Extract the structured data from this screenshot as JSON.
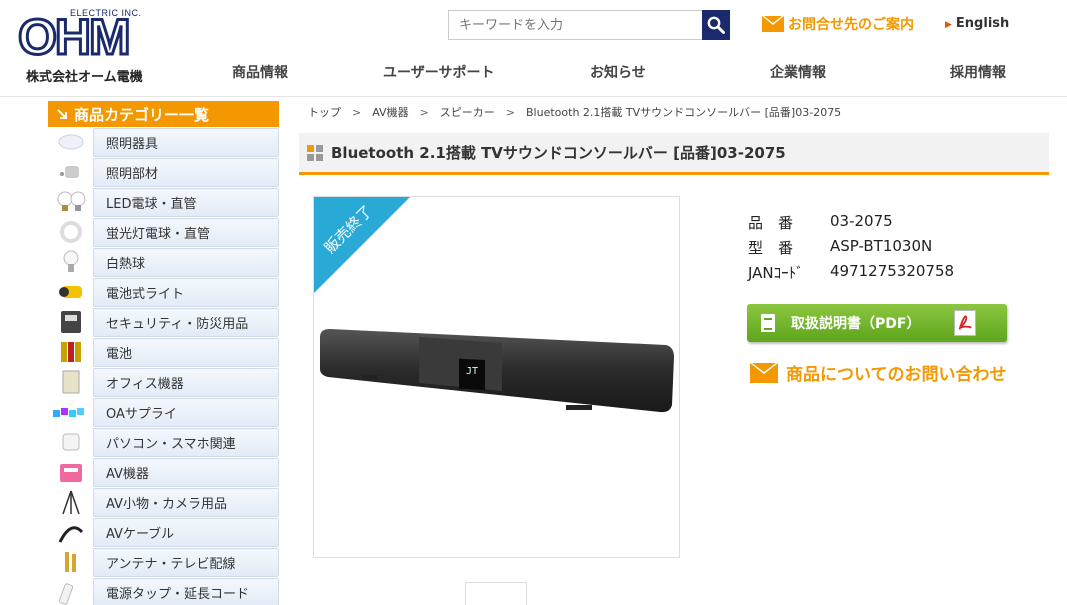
{
  "header": {
    "logo_small": "ELECTRIC INC.",
    "logo_big": "OHM",
    "logo_sub": "株式会社オーム電機",
    "search_placeholder": "キーワードを入力",
    "contact_label": "お問合せ先のご案内",
    "english_label": "English"
  },
  "nav": [
    {
      "label": "商品情報"
    },
    {
      "label": "ユーザーサポート"
    },
    {
      "label": "お知らせ"
    },
    {
      "label": "企業情報"
    },
    {
      "label": "採用情報"
    }
  ],
  "sidebar": {
    "heading": "商品カテゴリー一覧",
    "items": [
      {
        "label": "照明器具",
        "icon": "ceiling-light-icon"
      },
      {
        "label": "照明部材",
        "icon": "light-socket-icon"
      },
      {
        "label": "LED電球・直管",
        "icon": "led-bulb-icon"
      },
      {
        "label": "蛍光灯電球・直管",
        "icon": "fluorescent-lamp-icon"
      },
      {
        "label": "白熱球",
        "icon": "incandescent-bulb-icon"
      },
      {
        "label": "電池式ライト",
        "icon": "flashlight-icon"
      },
      {
        "label": "セキュリティ・防災用品",
        "icon": "sensor-light-icon"
      },
      {
        "label": "電池",
        "icon": "battery-icon"
      },
      {
        "label": "オフィス機器",
        "icon": "office-device-icon"
      },
      {
        "label": "OAサプライ",
        "icon": "oa-supply-icon"
      },
      {
        "label": "パソコン・スマホ関連",
        "icon": "usb-charger-icon"
      },
      {
        "label": "AV機器",
        "icon": "radio-icon"
      },
      {
        "label": "AV小物・カメラ用品",
        "icon": "tripod-icon"
      },
      {
        "label": "AVケーブル",
        "icon": "av-cable-icon"
      },
      {
        "label": "アンテナ・テレビ配線",
        "icon": "antenna-plug-icon"
      },
      {
        "label": "電源タップ・延長コード",
        "icon": "power-strip-icon"
      }
    ]
  },
  "breadcrumb": [
    "トップ",
    "AV機器",
    "スピーカー",
    "Bluetooth 2.1搭載 TVサウンドコンソールバー [品番]03-2075"
  ],
  "product": {
    "title": "Bluetooth 2.1搭載 TVサウンドコンソールバー [品番]03-2075",
    "badge": "販売終了",
    "screen_text": "JT",
    "spec": [
      {
        "key": "品　番",
        "value": "03-2075"
      },
      {
        "key": "型　番",
        "value": "ASP-BT1030N"
      },
      {
        "key": "JANｺｰﾄﾞ",
        "value": "4971275320758"
      }
    ],
    "manual_label": "取扱説明書（PDF）",
    "inquiry_label": "商品についてのお問い合わせ"
  },
  "colors": {
    "brand_navy": "#1a2a6c",
    "accent_orange": "#f39800",
    "button_green": "#6cb12b",
    "badge_blue": "#29a9d6"
  }
}
